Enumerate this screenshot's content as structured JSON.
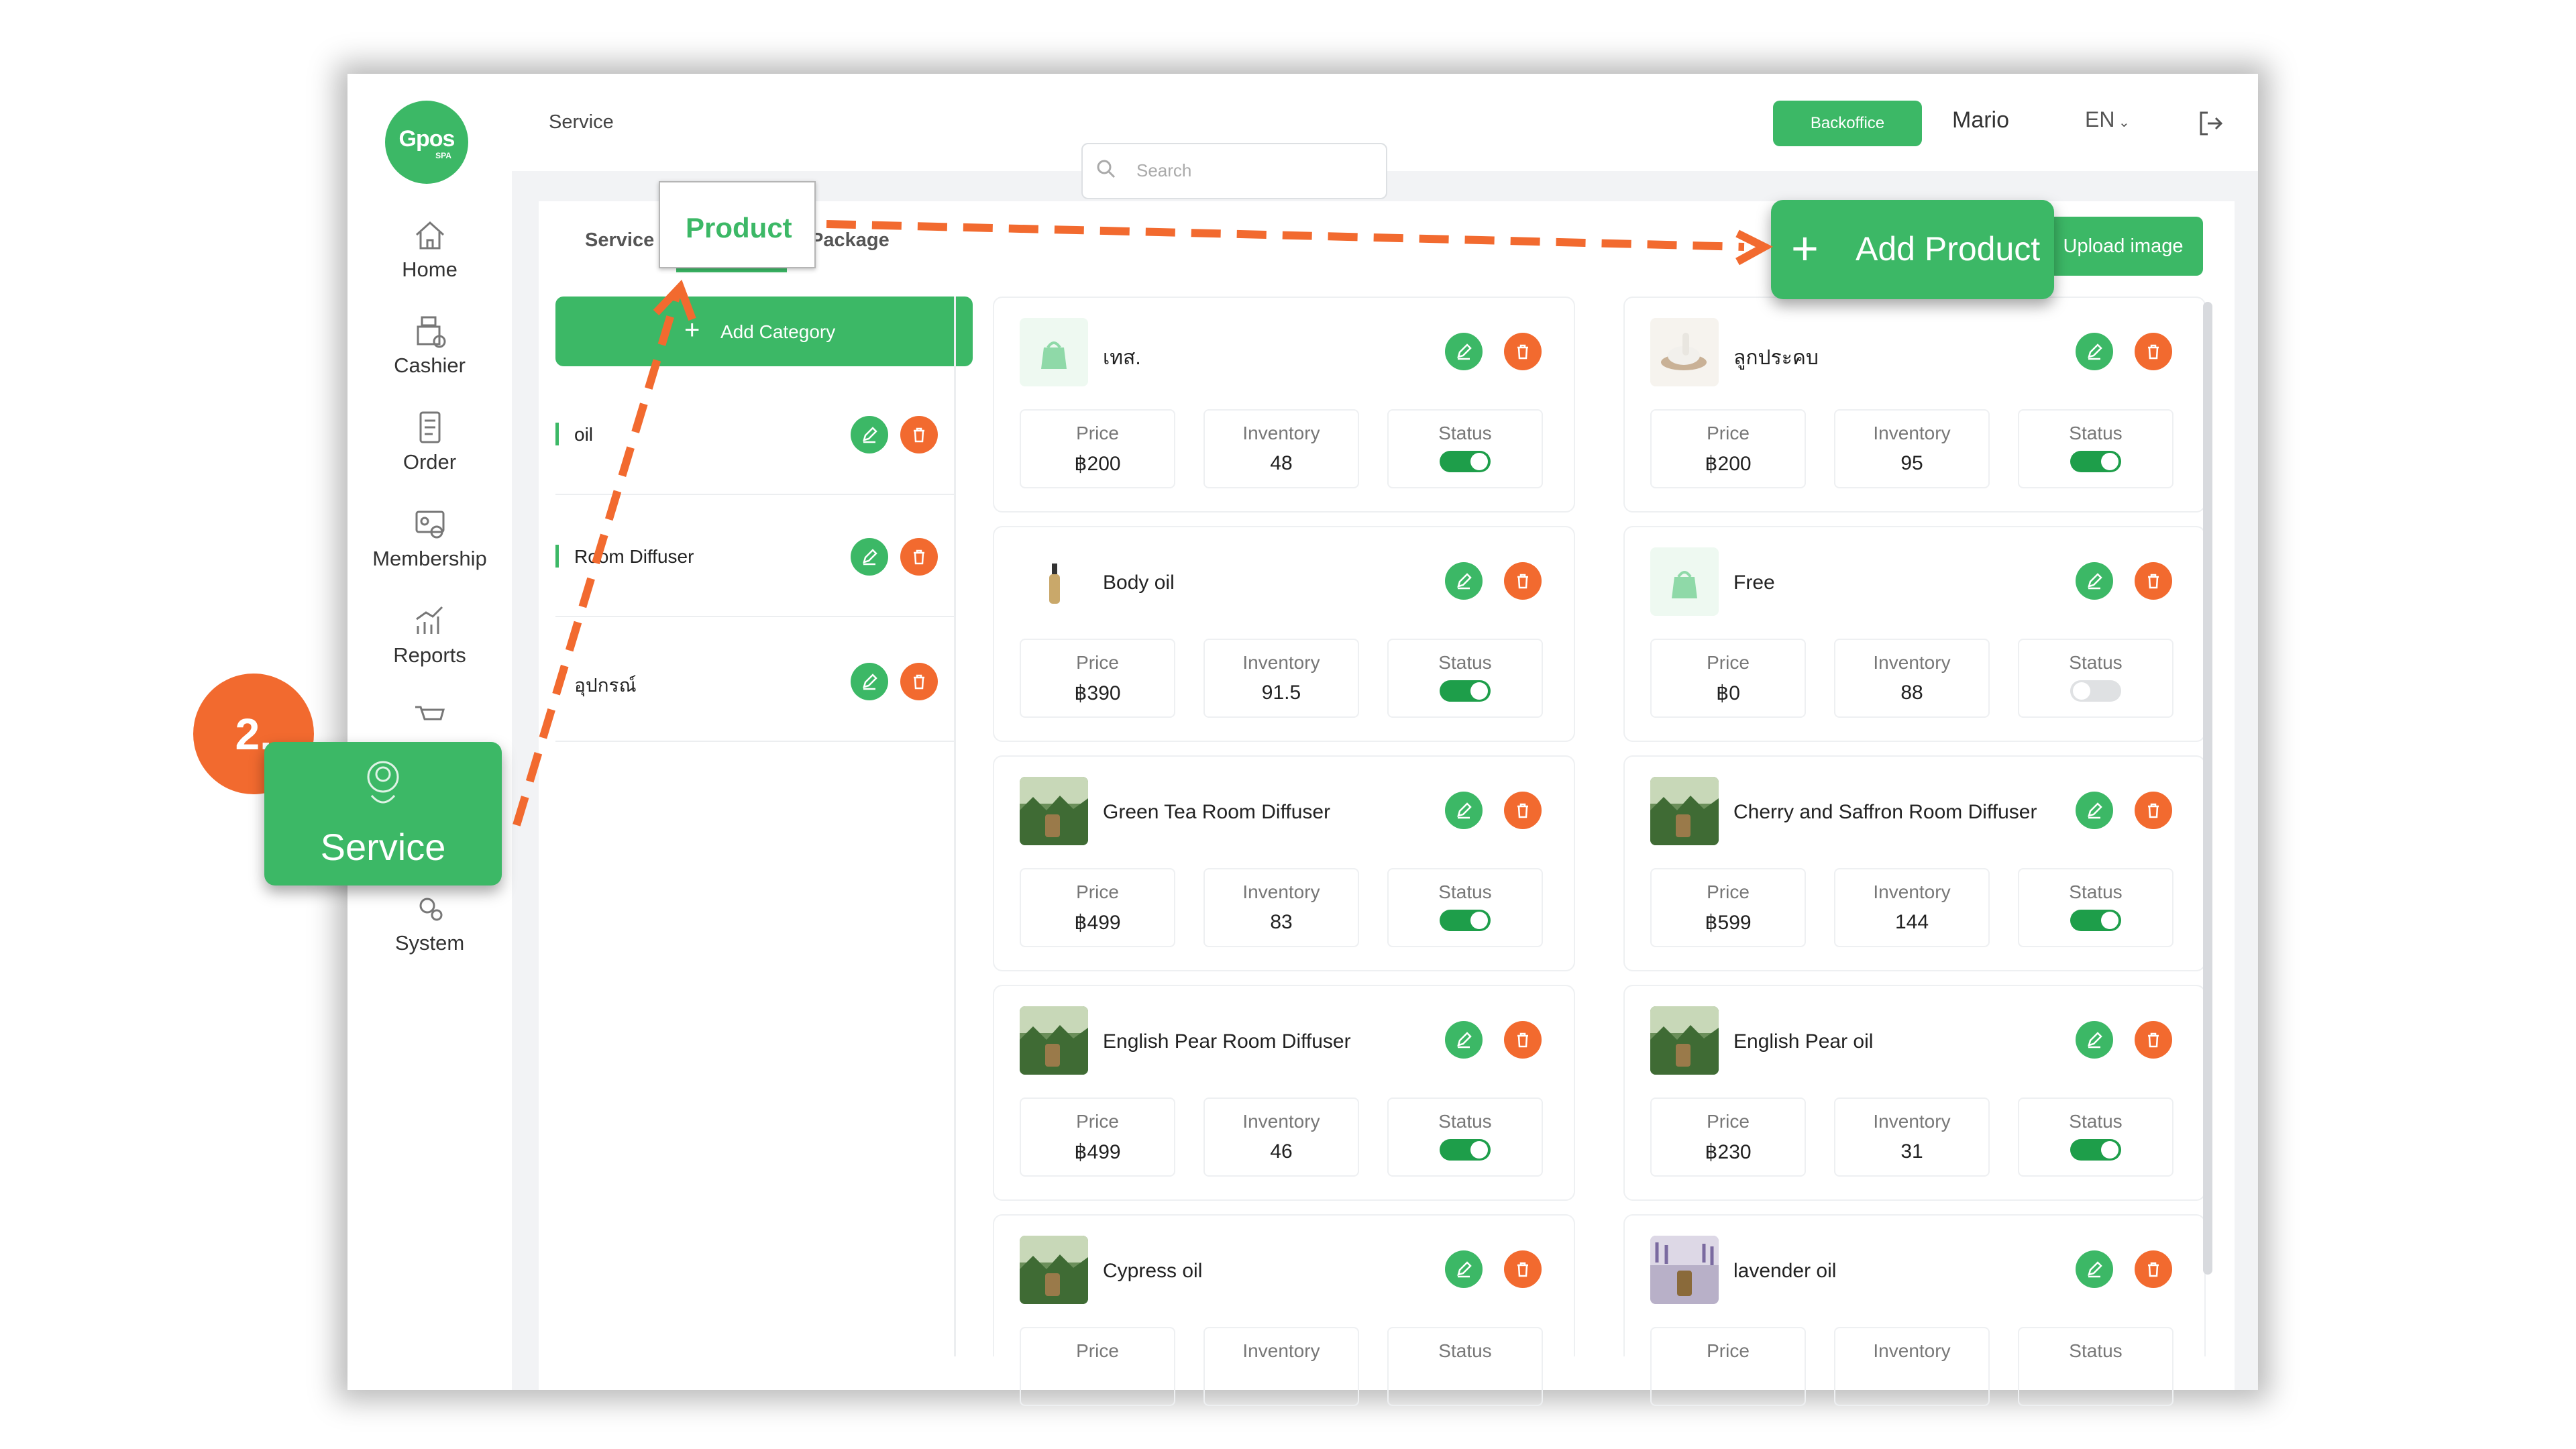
{
  "colors": {
    "accent": "#3cb866",
    "danger": "#f26a2f",
    "toggle_on": "#1e9e4a"
  },
  "logo": {
    "text": "Gpos",
    "sub": "SPA"
  },
  "sidebar": {
    "items": [
      {
        "label": "Home",
        "icon": "home-icon"
      },
      {
        "label": "Cashier",
        "icon": "cashier-icon"
      },
      {
        "label": "Order",
        "icon": "order-icon"
      },
      {
        "label": "Membership",
        "icon": "membership-icon"
      },
      {
        "label": "Reports",
        "icon": "reports-icon"
      },
      {
        "label": "System",
        "icon": "system-icon"
      }
    ]
  },
  "topbar": {
    "breadcrumb": "Service",
    "backoffice": "Backoffice",
    "user": "Mario",
    "lang": "EN"
  },
  "tabs": {
    "service": "Service",
    "product": "Product",
    "package": "Package"
  },
  "search": {
    "placeholder": "Search"
  },
  "actions": {
    "add_product": "Add Product",
    "upload_image": "Upload image",
    "add_category": "Add Category"
  },
  "categories": [
    "oil",
    "Room Diffuser",
    "อุปกรณ์"
  ],
  "labels": {
    "price": "Price",
    "inventory": "Inventory",
    "status": "Status"
  },
  "products": [
    {
      "name": "เทส.",
      "price": "฿200",
      "inventory": "48",
      "status": "on"
    },
    {
      "name": "ลูกประคบ",
      "price": "฿200",
      "inventory": "95",
      "status": "on"
    },
    {
      "name": "Body oil",
      "price": "฿390",
      "inventory": "91.5",
      "status": "on"
    },
    {
      "name": "Free",
      "price": "฿0",
      "inventory": "88",
      "status": "off"
    },
    {
      "name": "Green Tea Room Diffuser",
      "price": "฿499",
      "inventory": "83",
      "status": "on"
    },
    {
      "name": "Cherry and Saffron Room Diffuser",
      "price": "฿599",
      "inventory": "144",
      "status": "on"
    },
    {
      "name": "English Pear Room Diffuser",
      "price": "฿499",
      "inventory": "46",
      "status": "on"
    },
    {
      "name": "English Pear oil",
      "price": "฿230",
      "inventory": "31",
      "status": "on"
    },
    {
      "name": "Cypress oil",
      "price": "",
      "inventory": "",
      "status": ""
    },
    {
      "name": "lavender oil",
      "price": "",
      "inventory": "",
      "status": ""
    }
  ],
  "callouts": {
    "step": "2.",
    "service_label": "Service",
    "service_icon": "spa-service-icon"
  }
}
